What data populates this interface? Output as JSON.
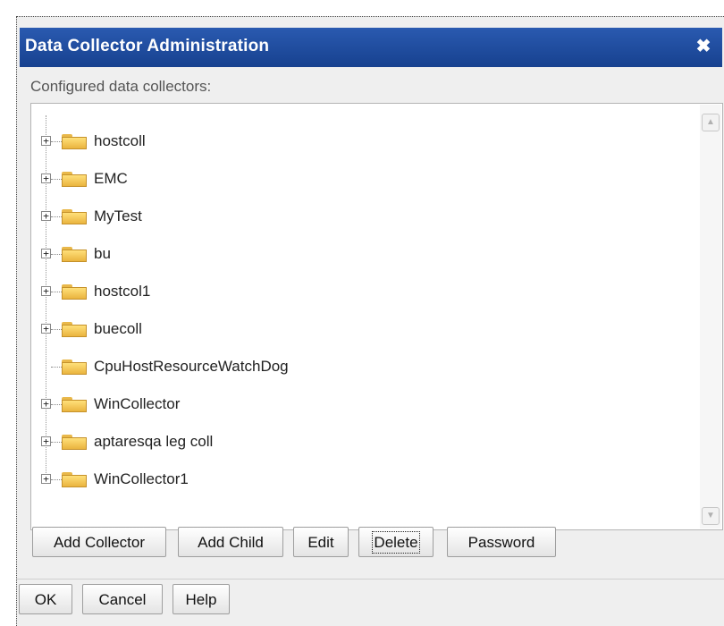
{
  "dialog": {
    "title": "Data Collector Administration",
    "close_glyph": "✖",
    "section_label": "Configured data collectors:"
  },
  "tree": {
    "nodes": [
      {
        "label": "hostcoll",
        "expandable": true
      },
      {
        "label": "EMC",
        "expandable": true
      },
      {
        "label": "MyTest",
        "expandable": true
      },
      {
        "label": "bu",
        "expandable": true
      },
      {
        "label": "hostcol1",
        "expandable": true
      },
      {
        "label": "buecoll",
        "expandable": true
      },
      {
        "label": "CpuHostResourceWatchDog",
        "expandable": false
      },
      {
        "label": "WinCollector",
        "expandable": true
      },
      {
        "label": "aptaresqa leg coll",
        "expandable": true
      },
      {
        "label": "WinCollector1",
        "expandable": true
      }
    ],
    "expander_glyph": "+"
  },
  "actions": {
    "add_collector": "Add Collector",
    "add_child": "Add Child",
    "edit": "Edit",
    "delete": "Delete",
    "password": "Password"
  },
  "footer": {
    "ok": "OK",
    "cancel": "Cancel",
    "help": "Help"
  },
  "colors": {
    "titlebar": "#1f4c9f",
    "folder": "#f2c455"
  },
  "icons": {
    "close": "close-icon",
    "folder": "folder-icon",
    "expander": "plus-box-icon",
    "scroll_up": "scroll-up-arrow-icon",
    "scroll_down": "scroll-down-arrow-icon"
  }
}
